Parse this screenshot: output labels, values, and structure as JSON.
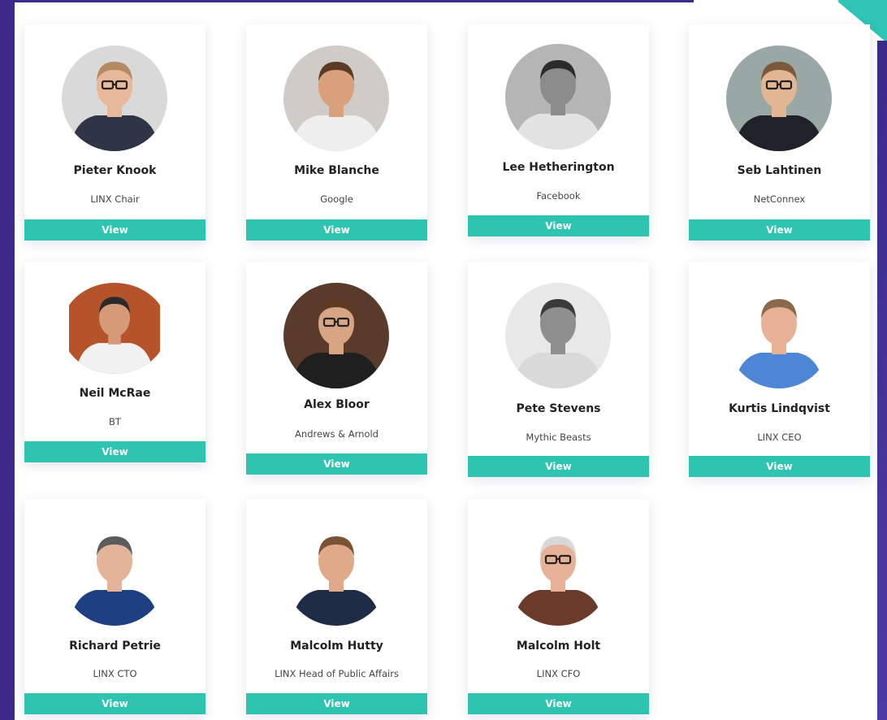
{
  "colors": {
    "accent": "#2ec4b0",
    "brand": "#3b2a8a",
    "card_bg": "#ffffff"
  },
  "people": [
    {
      "name": "Pieter Knook",
      "org": "LINX Chair",
      "view_label": "View",
      "photo": {
        "bg": "#d9d9d9",
        "skin": "#e7b89a",
        "hair": "#b38a62",
        "shirt": "#2f3447",
        "glasses": true
      }
    },
    {
      "name": "Mike Blanche",
      "org": "Google",
      "view_label": "View",
      "photo": {
        "bg": "#cfcbc6",
        "skin": "#d9a07c",
        "hair": "#5a3b25",
        "shirt": "#eeeeee",
        "glasses": false
      }
    },
    {
      "name": "Lee Hetherington",
      "org": "Facebook",
      "view_label": "View",
      "photo": {
        "bg": "#b5b5b5",
        "skin": "#8c8c8c",
        "hair": "#2b2b2b",
        "shirt": "#e2e2e2",
        "glasses": false
      }
    },
    {
      "name": "Seb Lahtinen",
      "org": "NetConnex",
      "view_label": "View",
      "photo": {
        "bg": "#9aa8a5",
        "skin": "#e2b593",
        "hair": "#7a5a3a",
        "shirt": "#1f2228",
        "glasses": true
      }
    },
    {
      "name": "Neil McRae",
      "org": "BT",
      "view_label": "View",
      "photo": {
        "bg": "#b5542b",
        "skin": "#d59a78",
        "hair": "#2a2a2a",
        "shirt": "#f1f1f1",
        "glasses": false
      }
    },
    {
      "name": "Alex Bloor",
      "org": "Andrews & Arnold",
      "view_label": "View",
      "photo": {
        "bg": "#5a3a2a",
        "skin": "#d7a484",
        "hair": "#5e3a22",
        "shirt": "#1f1f1f",
        "glasses": true
      }
    },
    {
      "name": "Pete Stevens",
      "org": "Mythic Beasts",
      "view_label": "View",
      "photo": {
        "bg": "#e8e8e8",
        "skin": "#8f8f8f",
        "hair": "#3a3a3a",
        "shirt": "#d9d9d9",
        "glasses": false
      }
    },
    {
      "name": "Kurtis Lindqvist",
      "org": "LINX CEO",
      "view_label": "View",
      "photo": {
        "bg": "#ffffff",
        "skin": "#e8b196",
        "hair": "#8a6a4a",
        "shirt": "#4d86d6",
        "glasses": false
      }
    },
    {
      "name": "Richard Petrie",
      "org": "LINX CTO",
      "view_label": "View",
      "photo": {
        "bg": "#ffffff",
        "skin": "#e3b39a",
        "hair": "#5c5c5c",
        "shirt": "#1e3f82",
        "glasses": false
      }
    },
    {
      "name": "Malcolm Hutty",
      "org": "LINX Head of Public Affairs",
      "view_label": "View",
      "photo": {
        "bg": "#ffffff",
        "skin": "#e0a98a",
        "hair": "#7a5234",
        "shirt": "#1f2c45",
        "glasses": false
      }
    },
    {
      "name": "Malcolm Holt",
      "org": "LINX CFO",
      "view_label": "View",
      "photo": {
        "bg": "#ffffff",
        "skin": "#e6b197",
        "hair": "#d8d8d8",
        "shirt": "#6a3a2a",
        "glasses": true
      }
    }
  ]
}
